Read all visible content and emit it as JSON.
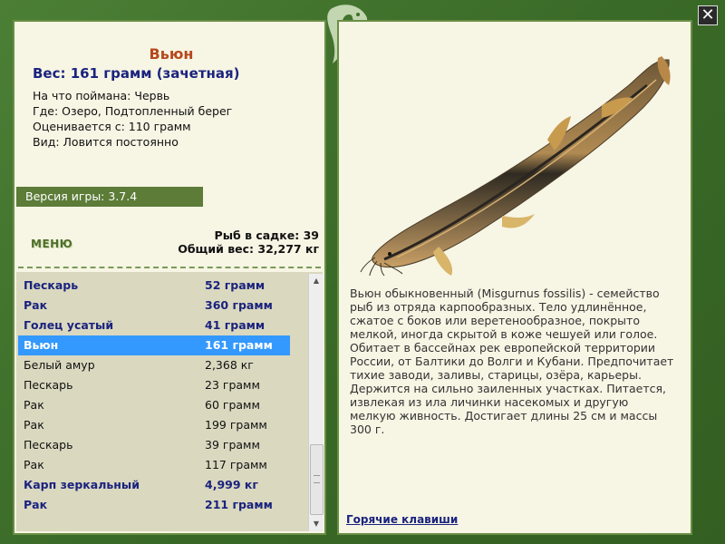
{
  "fish": {
    "title": "Вьюн",
    "weight_line": "Вес: 161 грамм (зачетная)",
    "info": [
      "На что поймана: Червь",
      "Где: Озеро, Подтопленный берег",
      "Оценивается с: 110 грамм",
      "Вид: Ловится постоянно"
    ]
  },
  "version": "Версия игры: 3.7.4",
  "menu_label": "МЕНЮ",
  "stats": {
    "count": "Рыб в садке: 39",
    "total": "Общий вес: 32,277 кг"
  },
  "catch_list": [
    {
      "name": "Пескарь",
      "weight": "52 грамм",
      "style": "bold"
    },
    {
      "name": "Рак",
      "weight": "360 грамм",
      "style": "bold"
    },
    {
      "name": "Голец усатый",
      "weight": "41 грамм",
      "style": "bold"
    },
    {
      "name": "Вьюн",
      "weight": "161 грамм",
      "style": "selected"
    },
    {
      "name": "Белый амур",
      "weight": "2,368 кг",
      "style": "plain"
    },
    {
      "name": "Пескарь",
      "weight": "23 грамм",
      "style": "plain"
    },
    {
      "name": "Рак",
      "weight": "60 грамм",
      "style": "plain"
    },
    {
      "name": "Рак",
      "weight": "199 грамм",
      "style": "plain"
    },
    {
      "name": "Пескарь",
      "weight": "39 грамм",
      "style": "plain"
    },
    {
      "name": "Рак",
      "weight": "117 грамм",
      "style": "plain"
    },
    {
      "name": "Карп зеркальный",
      "weight": "4,999 кг",
      "style": "bold"
    },
    {
      "name": "Рак",
      "weight": "211 грамм",
      "style": "bold"
    }
  ],
  "description": "Вьюн обыкновенный (Misgurnus fossilis) - семейство рыб из отряда карпообразных. Тело удлинённое, сжатое с боков или веретенообразное, покрыто мелкой, иногда скрытой в коже чешуей или голое. Обитает в бассейнах рек европейской территории России, от Балтики до Волги и Кубани. Предпочитает тихие заводи, заливы, старицы, озёра, карьеры. Держится на сильно заиленных участках. Питается, извлекая из ила личинки насекомых и другую мелкую живность. Достигает длины 25 см и массы 300 г.",
  "hotkeys_label": "Горячие клавиши",
  "close_symbol": "✕",
  "icons": {
    "close": "close-icon",
    "logo": "fish-logo-icon",
    "scroll_up": "scroll-up-icon",
    "scroll_down": "scroll-down-icon"
  },
  "colors": {
    "frame_green": "#3e6e2a",
    "panel_bg": "#f7f5e4",
    "title_orange": "#b5481b",
    "bold_blue": "#1a237e",
    "selected_blue": "#3399ff",
    "list_bg": "#dad8bf"
  }
}
